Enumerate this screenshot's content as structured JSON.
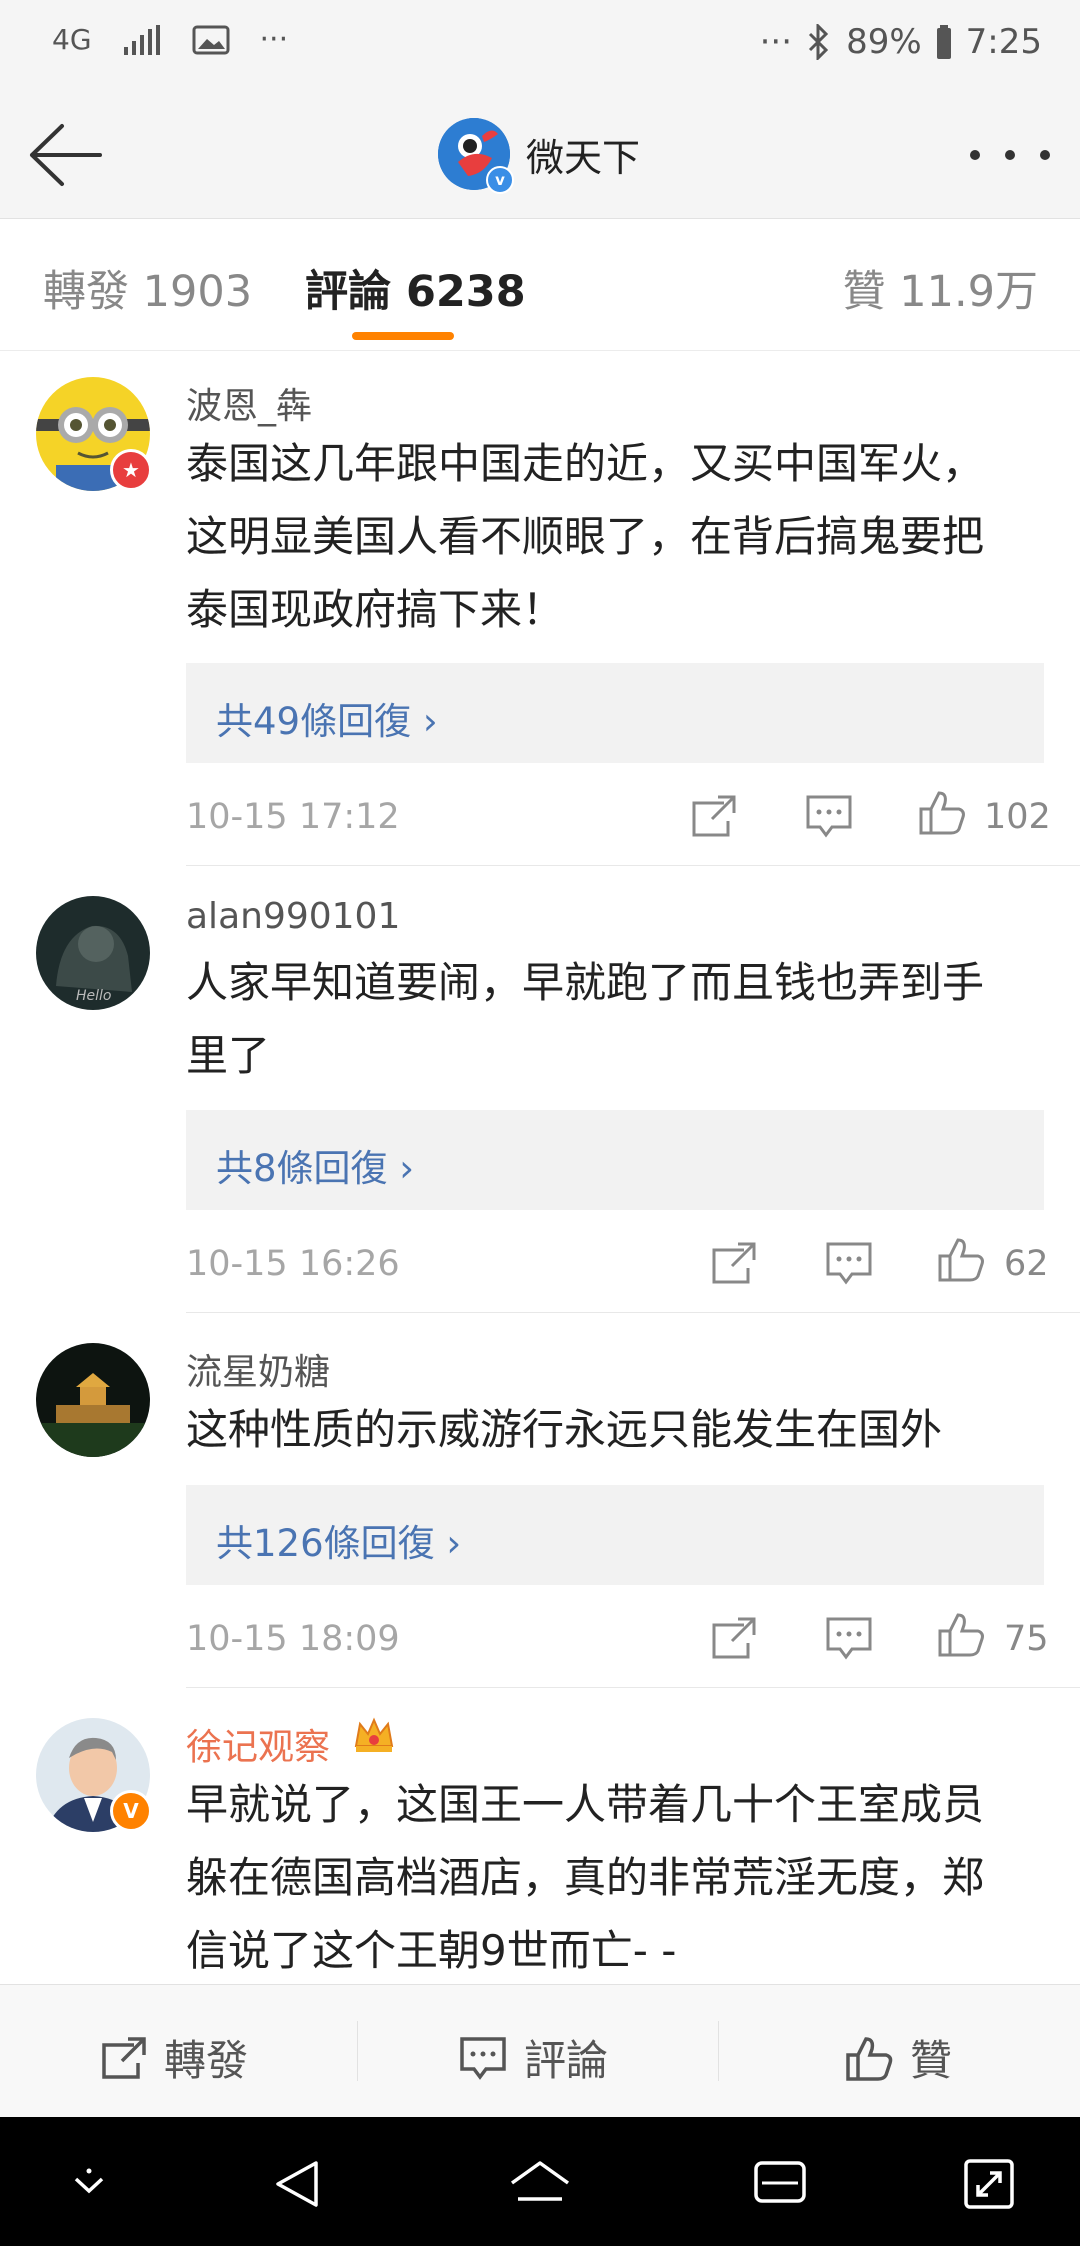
{
  "status_bar": {
    "network": "4G",
    "battery": "89%",
    "time": "7:25",
    "dots_left": "···",
    "dots_right": "···"
  },
  "header": {
    "title": "微天下",
    "verified_mark": "v"
  },
  "tabs": {
    "repost": "轉發 1903",
    "comments": "評論 6238",
    "likes": "贊 11.9万"
  },
  "comments": [
    {
      "username": "波恩_犇",
      "lines": [
        "泰国这几年跟中国走的近，又买中国军火，",
        "这明显美国人看不顺眼了，在背后搞鬼要把",
        "泰国现政府搞下来！"
      ],
      "replies": "共49條回復",
      "time": "10-15 17:12",
      "likes": "102"
    },
    {
      "username": "alan990101",
      "lines": [
        "人家早知道要闹，早就跑了而且钱也弄到手",
        "里了"
      ],
      "replies": "共8條回復",
      "time": "10-15 16:26",
      "likes": "62"
    },
    {
      "username": "流星奶糖",
      "lines": [
        "这种性质的示威游行永远只能发生在国外"
      ],
      "replies": "共126條回復",
      "time": "10-15 18:09",
      "likes": "75"
    },
    {
      "username": "徐记观察",
      "lines": [
        "早就说了，这国王一人带着几十个王室成员",
        "躲在德国高档酒店，真的非常荒淫无度，郑",
        "信说了这个王朝9世而亡- -"
      ]
    }
  ],
  "toolbar": {
    "repost": "轉發",
    "comment": "評論",
    "like": "贊"
  },
  "colors": {
    "accent": "#ff8200",
    "link": "#4a74b2",
    "vip_name": "#eb7350"
  }
}
